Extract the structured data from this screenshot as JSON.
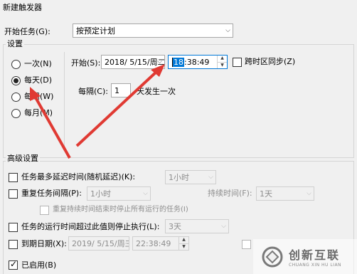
{
  "window": {
    "title": "新建触发器"
  },
  "begin_task": {
    "label": "开始任务(G):",
    "value": "按预定计划"
  },
  "settings": {
    "title": "设置",
    "radios": [
      {
        "label": "一次(N)",
        "checked": false
      },
      {
        "label": "每天(D)",
        "checked": true
      },
      {
        "label": "每周(W)",
        "checked": false
      },
      {
        "label": "每月(M)",
        "checked": false
      }
    ],
    "start_label": "开始(S):",
    "start_date": "2018/ 5/15/周二",
    "start_time_selected": "18",
    "start_time_rest": ":38:49",
    "sync_label": "跨时区同步(Z)",
    "recur_label": "每隔(C):",
    "recur_value": "1",
    "recur_suffix": "天发生一次"
  },
  "advanced": {
    "title": "高级设置",
    "delay_label": "任务最多延迟时间(随机延迟)(K):",
    "delay_value": "1小时",
    "repeat_label": "重复任务间隔(P):",
    "repeat_value": "1小时",
    "duration_label": "持续时间(F):",
    "duration_value": "1天",
    "stop_all_label": "重复持续时间结束时停止所有运行的任务(I)",
    "stop_if_longer_label": "任务的运行时间超过此值则停止执行(L):",
    "stop_if_longer_value": "3天",
    "expire_label": "到期日期(X):",
    "expire_date": "2019/ 5/15/周三",
    "expire_time": "22:38:49",
    "enabled_label": "已启用(B)"
  },
  "watermark": {
    "cn": "创新互联",
    "en": "CHUANG XIN HU LIAN"
  },
  "colors": {
    "arrow": "#e03a33",
    "focus": "#0078d7"
  }
}
